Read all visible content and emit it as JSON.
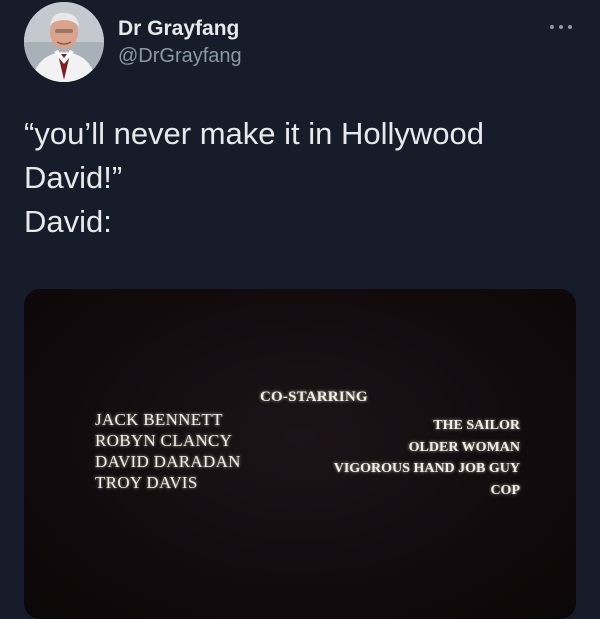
{
  "author": {
    "display_name": "Dr Grayfang",
    "handle": "@DrGrayfang",
    "avatar_icon": "profile-photo-icon"
  },
  "menu": {
    "more_icon": "more-options-icon"
  },
  "tweet": {
    "text": "“you’ll never make it in Hollywood\nDavid!”\nDavid:"
  },
  "media": {
    "heading": "CO-STARRING",
    "names": [
      "JACK BENNETT",
      "ROBYN CLANCY",
      "DAVID DARADAN",
      "TROY DAVIS"
    ],
    "roles": [
      "THE SAILOR",
      "OLDER WOMAN",
      "VIGOROUS HAND JOB GUY",
      "COP"
    ]
  },
  "colors": {
    "background": "#161c29",
    "text_primary": "#e7e9ea",
    "text_secondary": "#8b98a5"
  }
}
